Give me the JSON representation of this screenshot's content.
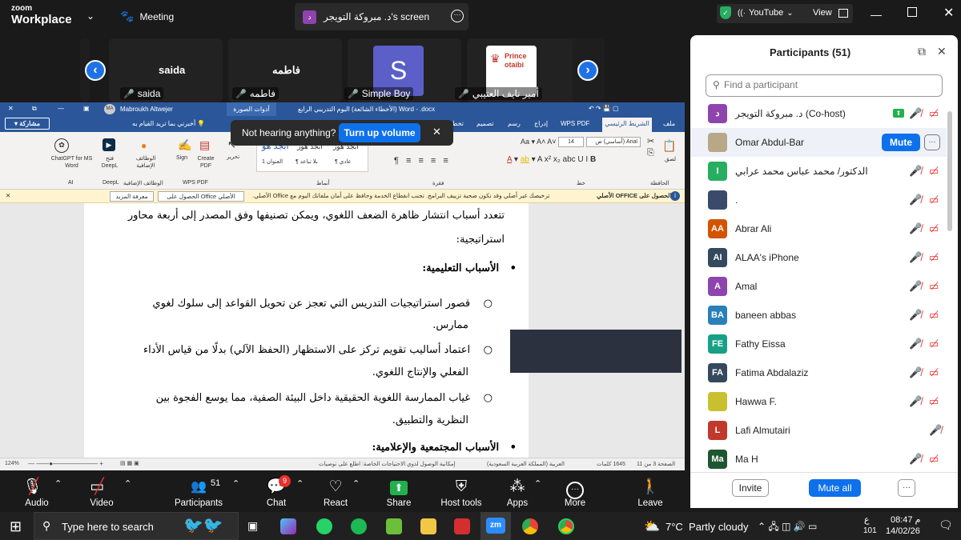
{
  "topbar": {
    "app_line1": "zoom",
    "app_line2": "Workplace",
    "meeting_label": "Meeting",
    "screen_avatar_letter": "د",
    "screen_title": "د. مبروكة التويجر's screen",
    "youtube_label": "YouTube",
    "view_label": "View"
  },
  "gallery": {
    "tiles": [
      {
        "display": "saida",
        "name": "saida"
      },
      {
        "display": "فاطمه",
        "name": "فاطمه"
      },
      {
        "display": "S",
        "name": "Simple Boy"
      },
      {
        "display": "Prince otaibi",
        "name": "أمير نايف العتيبي"
      }
    ]
  },
  "word": {
    "author": "Mabroukh Altwejer",
    "doc_title": "Word - .docx (الأخطاء الشائعة) البوم التدريبي الرابع",
    "picture_tools": "أدوات الصورة",
    "share_button": "مشاركة",
    "tell_me": "أخبرني بما تريد القيام به",
    "tabs": [
      "ملف",
      "الشريط الرئيسي",
      "WPS PDF",
      "إدراج",
      "رسم",
      "تصميم",
      "تخطيط",
      "مراجع"
    ],
    "ribbon": {
      "chatgpt": "ChatGPT for MS Word",
      "chatgpt_group": "AI",
      "deepl": "فتح DeepL",
      "deepl_group": "DeepL",
      "addins": "الوظائف الإضافية",
      "addins_group": "الوظائف الإضافية",
      "sign": "Sign",
      "create_pdf": "Create PDF",
      "wps_group": "WPS PDF",
      "edit": "تحرير",
      "styles_group": "أنماط",
      "style1_sample": "أبجد هوز",
      "style1": "¶ عادي",
      "style2_sample": "أبجد هوز",
      "style2": "¶ بلا تباعد",
      "style3_sample": "أبجد هو",
      "style3": "العنوان 1",
      "paragraph_group": "فقرة",
      "font_group": "خط",
      "font_name": "Arial (أساسي) ض",
      "font_size": "14",
      "paste": "لصق",
      "clipboard_group": "الحافظة"
    },
    "toast": {
      "text": "Not hearing anything?",
      "button": "Turn up volume"
    },
    "infobar": {
      "title": "الحصول على OFFICE الأصلي",
      "message": "ترخيصك غير أصلي وقد تكون ضحية تزييف البرامج. تجنب انقطاع الخدمة وحافظ على أمان ملفاتك اليوم مع Office الأصلي.",
      "get_button": "الحصول على Office الأصلي",
      "learn_button": "معرفة المزيد"
    },
    "doc_lines": [
      "تتعدد أسباب انتشار ظاهرة الضعف اللغوي، ويمكن تصنيفها وفق المصدر إلى أربعة محاور",
      "استراتيجية:",
      "الأسباب التعليمية:",
      "قصور استراتيجيات التدريس التي تعجز عن تحويل القواعد إلى سلوك لغوي",
      "ممارس.",
      "اعتماد أساليب تقويم تركز على الاستظهار (الحفظ الآلي) بدلًا من قياس الأداء",
      "الفعلي والإنتاج اللغوي.",
      "غياب الممارسة اللغوية الحقيقية داخل البيئة الصفية، مما يوسع الفجوة بين",
      "النظرية والتطبيق.",
      "الأسباب المجتمعية والإعلامية:"
    ],
    "status": {
      "page": "الصفحة 3 من 11",
      "words": "1645 كلمات",
      "lang": "العربية (المملكة العربية السعودية)",
      "access": "إمكانية الوصول لذوي الاحتياجات الخاصة: اطلع على توصيات",
      "zoom": "124%"
    }
  },
  "toolbar": {
    "audio": "Audio",
    "video": "Video",
    "participants": "Participants",
    "participants_count": "51",
    "chat": "Chat",
    "chat_badge": "9",
    "react": "React",
    "share": "Share",
    "host_tools": "Host tools",
    "apps": "Apps",
    "more": "More",
    "leave": "Leave"
  },
  "participants_panel": {
    "title": "Participants (51)",
    "search_placeholder": "Find a participant",
    "mute_button": "Mute",
    "invite": "Invite",
    "mute_all": "Mute all",
    "rows": [
      {
        "avatar": "د",
        "color": "#8e44ad",
        "name": "د. مبروكة التويجر (Co-host)"
      },
      {
        "avatar": "",
        "color": "#b8a888",
        "name": "Omar Abdul-Bar"
      },
      {
        "avatar": "I",
        "color": "#27ae60",
        "name": "الدكتور/ محمد عباس محمد عرابي"
      },
      {
        "avatar": "",
        "color": "#3a4a6b",
        "name": "."
      },
      {
        "avatar": "AA",
        "color": "#d35400",
        "name": "Abrar Ali"
      },
      {
        "avatar": "AI",
        "color": "#34495e",
        "name": "ALAA's iPhone"
      },
      {
        "avatar": "A",
        "color": "#8e44ad",
        "name": "Amal"
      },
      {
        "avatar": "BA",
        "color": "#2980b9",
        "name": "baneen abbas"
      },
      {
        "avatar": "FE",
        "color": "#16a085",
        "name": "Fathy Eissa"
      },
      {
        "avatar": "FA",
        "color": "#34495e",
        "name": "Fatima Abdalaziz"
      },
      {
        "avatar": "",
        "color": "#c9c030",
        "name": "Hawwa F."
      },
      {
        "avatar": "L",
        "color": "#c0392b",
        "name": "Lafi Almutairi"
      },
      {
        "avatar": "Ma",
        "color": "#1e5631",
        "name": "Ma H"
      }
    ]
  },
  "taskbar": {
    "search": "Type here to search",
    "weather": "7°C  Partly cloudy",
    "lang": "ع",
    "lang2": "101",
    "time": "08:47 م",
    "date": "14/02/26"
  }
}
